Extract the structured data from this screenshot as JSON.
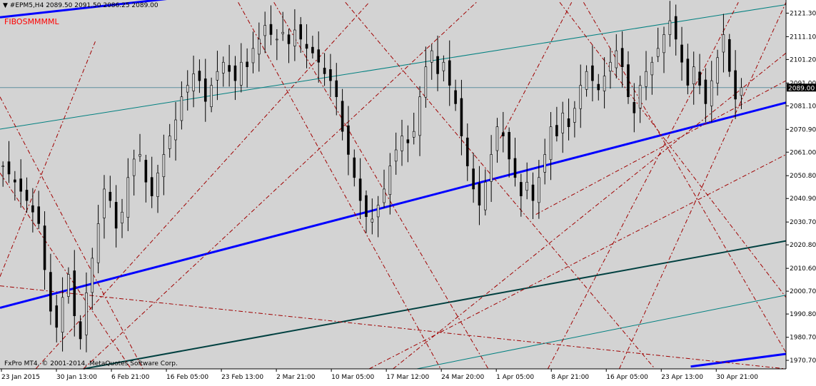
{
  "header": {
    "symbol_label": "#EPM5,H4",
    "ohlc_label": "2089.50 2091.50 2086.25 2089.00",
    "indicator_label": "FIBOSMMMML"
  },
  "footer": {
    "copyright": "FxPro MT4, © 2001-2014, MetaQuotes Software Corp."
  },
  "colors": {
    "background": "#d3d3d3",
    "candle": "#000000",
    "channel_main": "#0000ff",
    "channel_teal": "#008080",
    "channel_dark": "#004040",
    "fib_lines": "#a00000",
    "current_price_line": "#5f8fa0",
    "price_tag_bg": "#000000",
    "price_tag_text": "#ffffff",
    "indicator_text": "#ff0000"
  },
  "chart_data": {
    "type": "candlestick",
    "y_range": [
      1967.0,
      2127.0
    ],
    "y_ticks": [
      "2121.30",
      "2111.10",
      "2101.20",
      "2091.00",
      "2081.10",
      "2070.90",
      "2061.00",
      "2050.80",
      "2040.90",
      "2030.70",
      "2020.80",
      "2010.60",
      "2000.70",
      "1990.80",
      "1980.70",
      "1970.70"
    ],
    "x_ticks": [
      "23 Jan 2015",
      "30 Jan 13:00",
      "6 Feb 21:00",
      "16 Feb 05:00",
      "23 Feb 13:00",
      "2 Mar 21:00",
      "10 Mar 05:00",
      "17 Mar 12:00",
      "24 Mar 20:00",
      "1 Apr 05:00",
      "8 Apr 21:00",
      "16 Apr 05:00",
      "23 Apr 13:00",
      "30 Apr 21:00"
    ],
    "current_price": "2089.00",
    "close_path": [
      [
        0,
        2055
      ],
      [
        2,
        2048
      ],
      [
        4,
        2040
      ],
      [
        6,
        2030
      ],
      [
        7,
        2010
      ],
      [
        8,
        1992
      ],
      [
        9,
        1985
      ],
      [
        10,
        1998
      ],
      [
        11,
        2008
      ],
      [
        12,
        1990
      ],
      [
        13,
        1980
      ],
      [
        14,
        2000
      ],
      [
        15,
        2015
      ],
      [
        16,
        2030
      ],
      [
        17,
        2045
      ],
      [
        18,
        2040
      ],
      [
        19,
        2028
      ],
      [
        20,
        2035
      ],
      [
        21,
        2050
      ],
      [
        22,
        2058
      ],
      [
        23,
        2060
      ],
      [
        24,
        2048
      ],
      [
        25,
        2042
      ],
      [
        26,
        2052
      ],
      [
        27,
        2060
      ],
      [
        28,
        2068
      ],
      [
        29,
        2075
      ],
      [
        30,
        2085
      ],
      [
        31,
        2090
      ],
      [
        32,
        2095
      ],
      [
        33,
        2092
      ],
      [
        34,
        2083
      ],
      [
        35,
        2090
      ],
      [
        36,
        2096
      ],
      [
        37,
        2100
      ],
      [
        38,
        2096
      ],
      [
        39,
        2092
      ],
      [
        40,
        2100
      ],
      [
        41,
        2098
      ],
      [
        42,
        2106
      ],
      [
        43,
        2110
      ],
      [
        44,
        2116
      ],
      [
        45,
        2112
      ],
      [
        46,
        2110
      ],
      [
        47,
        2113
      ],
      [
        48,
        2108
      ],
      [
        49,
        2114
      ],
      [
        50,
        2110
      ],
      [
        51,
        2106
      ],
      [
        52,
        2104
      ],
      [
        53,
        2100
      ],
      [
        54,
        2095
      ],
      [
        55,
        2092
      ],
      [
        56,
        2085
      ],
      [
        57,
        2070
      ],
      [
        58,
        2060
      ],
      [
        59,
        2050
      ],
      [
        60,
        2040
      ],
      [
        61,
        2033
      ],
      [
        62,
        2032
      ],
      [
        63,
        2038
      ],
      [
        64,
        2045
      ],
      [
        65,
        2055
      ],
      [
        66,
        2062
      ],
      [
        67,
        2068
      ],
      [
        68,
        2065
      ],
      [
        69,
        2070
      ],
      [
        70,
        2085
      ],
      [
        71,
        2098
      ],
      [
        72,
        2105
      ],
      [
        73,
        2095
      ],
      [
        74,
        2100
      ],
      [
        75,
        2090
      ],
      [
        76,
        2082
      ],
      [
        77,
        2068
      ],
      [
        78,
        2055
      ],
      [
        79,
        2045
      ],
      [
        80,
        2038
      ],
      [
        81,
        2048
      ],
      [
        82,
        2060
      ],
      [
        83,
        2072
      ],
      [
        84,
        2068
      ],
      [
        85,
        2058
      ],
      [
        86,
        2050
      ],
      [
        87,
        2042
      ],
      [
        88,
        2048
      ],
      [
        89,
        2040
      ],
      [
        90,
        2050
      ],
      [
        91,
        2060
      ],
      [
        92,
        2072
      ],
      [
        93,
        2068
      ],
      [
        94,
        2078
      ],
      [
        95,
        2072
      ],
      [
        96,
        2080
      ],
      [
        97,
        2090
      ],
      [
        98,
        2096
      ],
      [
        99,
        2092
      ],
      [
        100,
        2088
      ],
      [
        101,
        2094
      ],
      [
        102,
        2100
      ],
      [
        103,
        2105
      ],
      [
        104,
        2098
      ],
      [
        105,
        2085
      ],
      [
        106,
        2078
      ],
      [
        107,
        2090
      ],
      [
        108,
        2096
      ],
      [
        109,
        2100
      ],
      [
        110,
        2106
      ],
      [
        111,
        2112
      ],
      [
        112,
        2118
      ],
      [
        113,
        2110
      ],
      [
        114,
        2100
      ],
      [
        115,
        2090
      ],
      [
        116,
        2098
      ],
      [
        117,
        2090
      ],
      [
        118,
        2082
      ],
      [
        119,
        2092
      ],
      [
        120,
        2102
      ],
      [
        121,
        2112
      ],
      [
        122,
        2096
      ],
      [
        123,
        2084
      ],
      [
        124,
        2089
      ]
    ],
    "trend_lines": [
      {
        "style": "channel_main",
        "width": 3,
        "p1": [
          0,
          2119.5
        ],
        "p2": [
          44,
          2132.0
        ]
      },
      {
        "style": "channel_main",
        "width": 3,
        "p1": [
          0,
          1993.5
        ],
        "p2": [
          132,
          2082.5
        ]
      },
      {
        "style": "channel_main",
        "width": 3,
        "p1": [
          116,
          1968.0
        ],
        "p2": [
          132,
          1973.5
        ]
      },
      {
        "style": "channel_teal",
        "width": 1,
        "p1": [
          0,
          2071.0
        ],
        "p2": [
          132,
          2125.0
        ]
      },
      {
        "style": "channel_teal",
        "width": 1,
        "p1": [
          70,
          1967.0
        ],
        "p2": [
          132,
          1999.0
        ]
      },
      {
        "style": "channel_dark",
        "width": 2,
        "p1": [
          14,
          1967.0
        ],
        "p2": [
          132,
          2022.5
        ]
      },
      {
        "style": "fib_lines",
        "width": 1,
        "p1": [
          0,
          2007.0
        ],
        "p2": [
          16,
          2109.0
        ]
      },
      {
        "style": "fib_lines",
        "width": 1,
        "p1": [
          0,
          2085.0
        ],
        "p2": [
          24,
          1967.0
        ]
      },
      {
        "style": "fib_lines",
        "width": 1,
        "p1": [
          0,
          2003.0
        ],
        "p2": [
          132,
          1967.0
        ]
      },
      {
        "style": "fib_lines",
        "width": 1,
        "p1": [
          0,
          2052.0
        ],
        "p2": [
          22,
          1967.0
        ]
      },
      {
        "style": "fib_lines",
        "width": 1,
        "p1": [
          6,
          1967.0
        ],
        "p2": [
          62,
          2126.0
        ]
      },
      {
        "style": "fib_lines",
        "width": 1,
        "p1": [
          14,
          1967.0
        ],
        "p2": [
          80,
          2126.0
        ]
      },
      {
        "style": "fib_lines",
        "width": 1,
        "p1": [
          40,
          2126.0
        ],
        "p2": [
          74,
          1967.0
        ]
      },
      {
        "style": "fib_lines",
        "width": 1,
        "p1": [
          46,
          2126.0
        ],
        "p2": [
          82,
          1967.0
        ]
      },
      {
        "style": "fib_lines",
        "width": 1,
        "p1": [
          58,
          2126.0
        ],
        "p2": [
          110,
          1967.0
        ]
      },
      {
        "style": "fib_lines",
        "width": 1,
        "p1": [
          66,
          1967.0
        ],
        "p2": [
          132,
          2104.0
        ]
      },
      {
        "style": "fib_lines",
        "width": 1,
        "p1": [
          62,
          1967.0
        ],
        "p2": [
          132,
          2060.0
        ]
      },
      {
        "style": "fib_lines",
        "width": 1,
        "p1": [
          84,
          2067.0
        ],
        "p2": [
          96,
          2126.0
        ]
      },
      {
        "style": "fib_lines",
        "width": 1,
        "p1": [
          94,
          2126.0
        ],
        "p2": [
          132,
          1998.0
        ]
      },
      {
        "style": "fib_lines",
        "width": 1,
        "p1": [
          98,
          2126.0
        ],
        "p2": [
          132,
          1974.0
        ]
      },
      {
        "style": "fib_lines",
        "width": 1,
        "p1": [
          104,
          1967.0
        ],
        "p2": [
          132,
          2126.0
        ]
      },
      {
        "style": "fib_lines",
        "width": 1,
        "p1": [
          92,
          1967.0
        ],
        "p2": [
          124,
          2126.0
        ]
      },
      {
        "style": "fib_lines",
        "width": 1,
        "p1": [
          90,
          2034.0
        ],
        "p2": [
          132,
          2092.0
        ]
      }
    ]
  }
}
